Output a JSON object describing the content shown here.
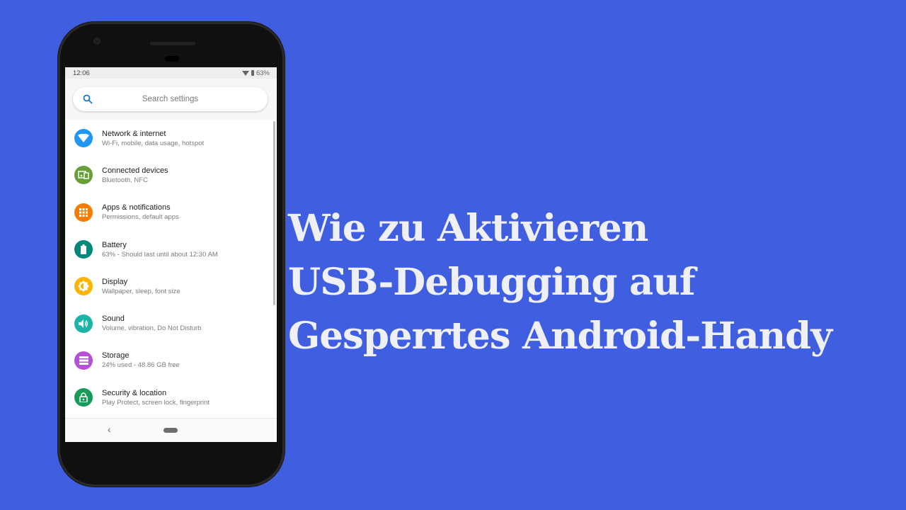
{
  "headline": {
    "lines": [
      "Wie zu Aktivieren",
      "USB-Debugging auf",
      "Gesperrtes Android-Handy"
    ]
  },
  "phone": {
    "status_bar": {
      "time": "12:06",
      "battery": "63%",
      "icons": [
        "wifi-icon",
        "battery-icon"
      ]
    },
    "search": {
      "placeholder": "Search settings",
      "icon": "search-icon"
    },
    "settings_items": [
      {
        "title": "Network & internet",
        "subtitle": "Wi-Fi, mobile, data usage, hotspot",
        "icon": "wifi-icon",
        "color": "#2196f3"
      },
      {
        "title": "Connected devices",
        "subtitle": "Bluetooth, NFC",
        "icon": "devices-icon",
        "color": "#689f38"
      },
      {
        "title": "Apps & notifications",
        "subtitle": "Permissions, default apps",
        "icon": "apps-icon",
        "color": "#f57c00"
      },
      {
        "title": "Battery",
        "subtitle": "63% - Should last until about 12:30 AM",
        "icon": "battery-icon",
        "color": "#00897b"
      },
      {
        "title": "Display",
        "subtitle": "Wallpaper, sleep, font size",
        "icon": "brightness-icon",
        "color": "#fbb400"
      },
      {
        "title": "Sound",
        "subtitle": "Volume, vibration, Do Not Disturb",
        "icon": "volume-icon",
        "color": "#1cb3a8"
      },
      {
        "title": "Storage",
        "subtitle": "24% used - 48.86 GB free",
        "icon": "storage-icon",
        "color": "#b74fd8"
      },
      {
        "title": "Security & location",
        "subtitle": "Play Protect, screen lock, fingerprint",
        "icon": "lock-icon",
        "color": "#1a9a5a"
      }
    ],
    "nav_bar": {
      "back_glyph": "‹"
    }
  }
}
